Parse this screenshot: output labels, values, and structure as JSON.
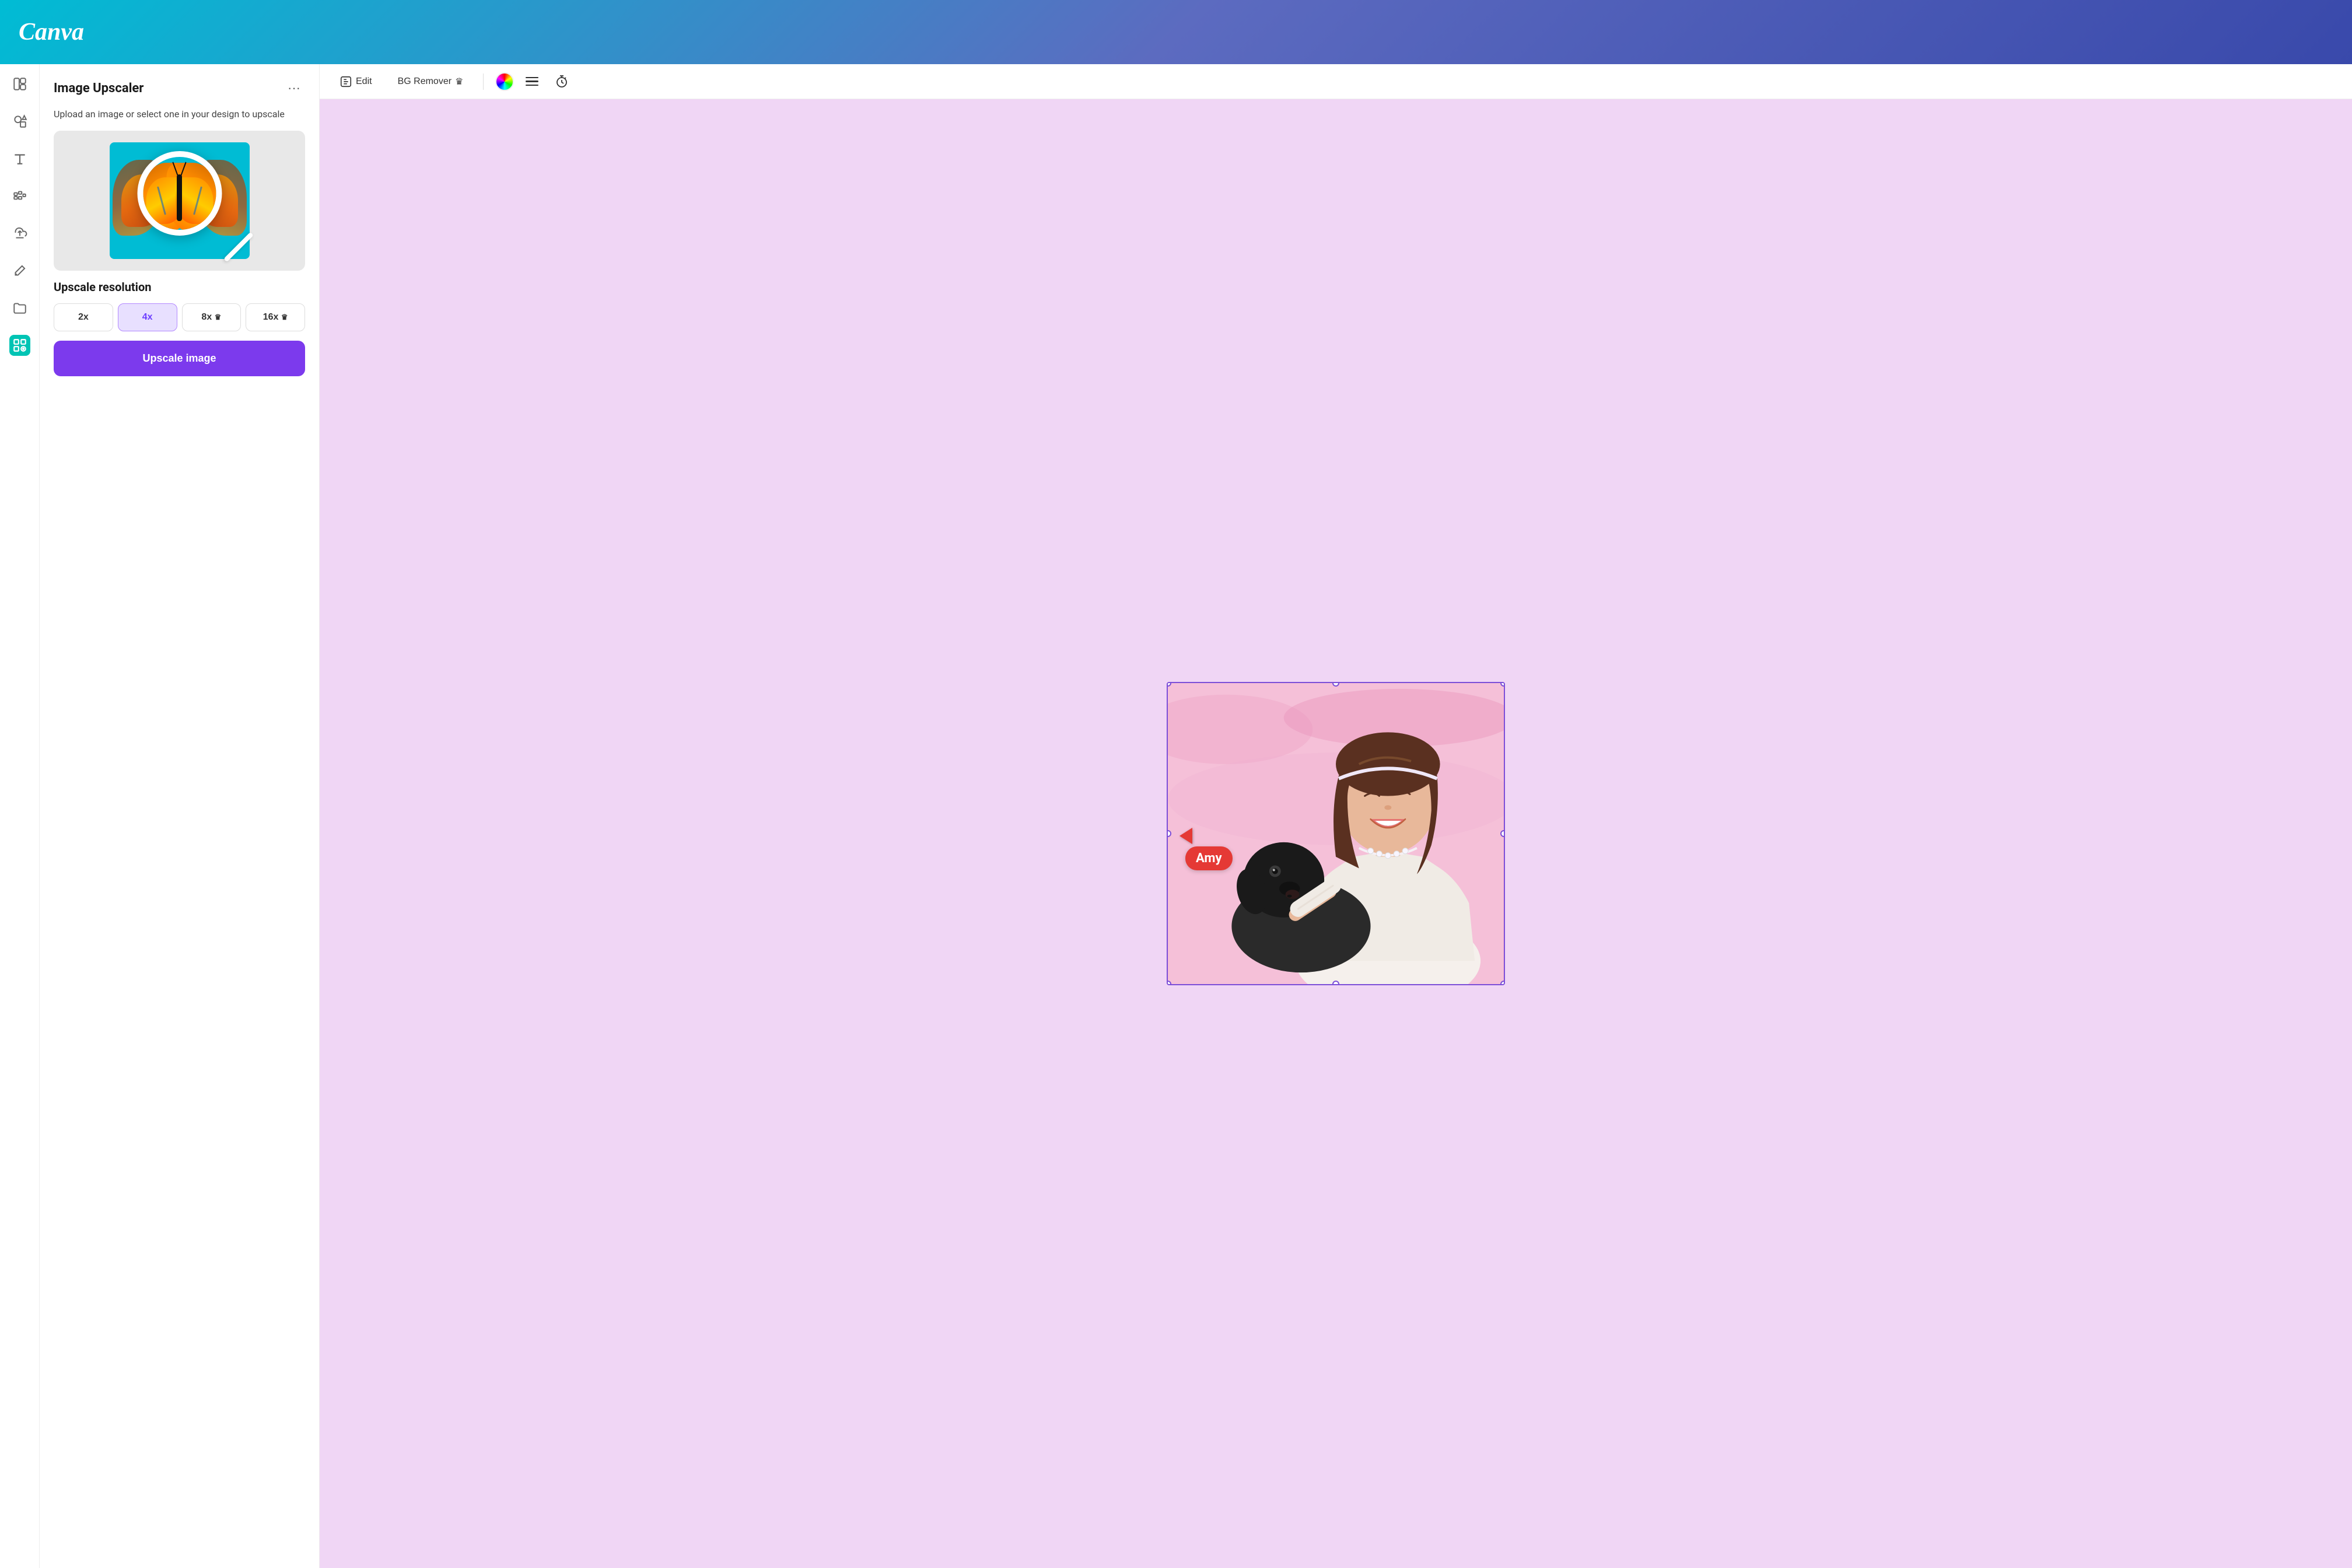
{
  "header": {
    "logo": "Canva",
    "background_gradient": "linear-gradient(135deg, #00bcd4 0%, #5c6bc0 50%, #3949ab 100%)"
  },
  "sidebar": {
    "items": [
      {
        "id": "layout",
        "icon": "layout-icon",
        "label": "Layout"
      },
      {
        "id": "elements",
        "icon": "elements-icon",
        "label": "Elements"
      },
      {
        "id": "text",
        "icon": "text-icon",
        "label": "Text"
      },
      {
        "id": "music",
        "icon": "music-icon",
        "label": "Music"
      },
      {
        "id": "uploads",
        "icon": "uploads-icon",
        "label": "Uploads"
      },
      {
        "id": "draw",
        "icon": "draw-icon",
        "label": "Draw"
      },
      {
        "id": "folders",
        "icon": "folders-icon",
        "label": "Folders"
      },
      {
        "id": "apps",
        "icon": "apps-icon",
        "label": "Apps",
        "active": true
      }
    ]
  },
  "panel": {
    "title": "Image Upscaler",
    "description": "Upload an image or select one in your design to upscale",
    "more_label": "···",
    "resolution_label": "Upscale resolution",
    "resolutions": [
      {
        "value": "2x",
        "label": "2x",
        "premium": false,
        "active": false
      },
      {
        "value": "4x",
        "label": "4x",
        "premium": false,
        "active": true
      },
      {
        "value": "8x",
        "label": "8x ♛",
        "premium": true,
        "active": false
      },
      {
        "value": "16x",
        "label": "16x ♛",
        "premium": true,
        "active": false
      }
    ],
    "upscale_button": "Upscale image"
  },
  "toolbar": {
    "edit_label": "Edit",
    "bg_remover_label": "BG Remover",
    "crown_icon": "♛"
  },
  "canvas": {
    "collaborator_name": "Amy",
    "collaborator_color": "#e53935"
  }
}
